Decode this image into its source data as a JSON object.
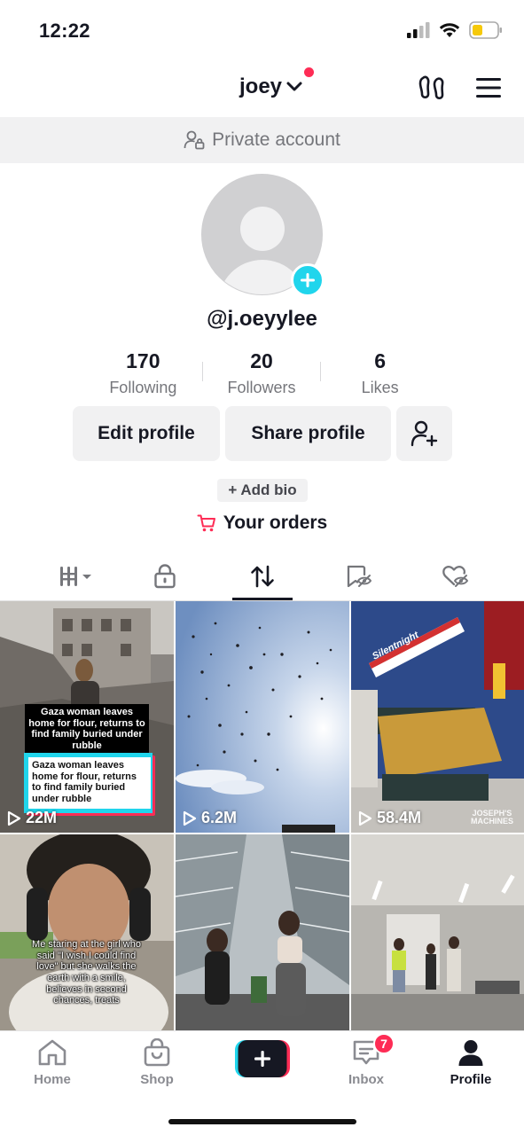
{
  "status_bar": {
    "time": "12:22"
  },
  "header": {
    "username": "joey"
  },
  "private_banner": {
    "text": "Private account"
  },
  "profile": {
    "handle": "@j.oeyylee",
    "stats": [
      {
        "value": "170",
        "label": "Following"
      },
      {
        "value": "20",
        "label": "Followers"
      },
      {
        "value": "6",
        "label": "Likes"
      }
    ],
    "edit_label": "Edit profile",
    "share_label": "Share profile",
    "add_bio": "+ Add bio",
    "orders": "Your orders"
  },
  "tabs": [
    {
      "icon": "videos-grid-icon",
      "active": false
    },
    {
      "icon": "lock-icon",
      "active": false
    },
    {
      "icon": "repost-icon",
      "active": true
    },
    {
      "icon": "favorites-hidden-icon",
      "active": false
    },
    {
      "icon": "liked-hidden-icon",
      "active": false
    }
  ],
  "videos": [
    {
      "views": "22M",
      "caption_top": "Gaza woman leaves home for flour, returns to find family buried under rubble",
      "caption_card": "Gaza woman leaves home for flour, returns to find family buried under rubble"
    },
    {
      "views": "6.2M"
    },
    {
      "views": "58.4M",
      "brand": "JOSEPH'S MACHINES",
      "box_text": "Silentnight"
    },
    {
      "caption": "Me staring at the girl who said \"I wish I could find love\" but she walks the earth with a smile, believes in second chances, treats"
    },
    {},
    {}
  ],
  "bottom_nav": {
    "home": "Home",
    "shop": "Shop",
    "inbox": "Inbox",
    "inbox_badge": "7",
    "profile": "Profile"
  },
  "colors": {
    "accent": "#fe2c55",
    "cyan": "#20d5ec",
    "text": "#161823",
    "muted": "#75767b"
  }
}
